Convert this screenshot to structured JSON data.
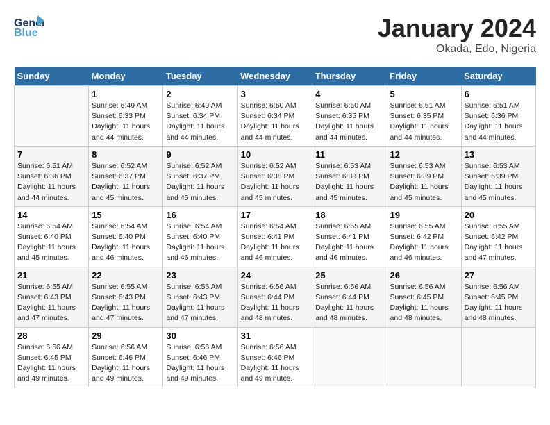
{
  "header": {
    "logo_general": "General",
    "logo_blue": "Blue",
    "month": "January 2024",
    "location": "Okada, Edo, Nigeria"
  },
  "weekdays": [
    "Sunday",
    "Monday",
    "Tuesday",
    "Wednesday",
    "Thursday",
    "Friday",
    "Saturday"
  ],
  "weeks": [
    [
      {
        "day": "",
        "sunrise": "",
        "sunset": "",
        "daylight": ""
      },
      {
        "day": "1",
        "sunrise": "Sunrise: 6:49 AM",
        "sunset": "Sunset: 6:33 PM",
        "daylight": "Daylight: 11 hours and 44 minutes."
      },
      {
        "day": "2",
        "sunrise": "Sunrise: 6:49 AM",
        "sunset": "Sunset: 6:34 PM",
        "daylight": "Daylight: 11 hours and 44 minutes."
      },
      {
        "day": "3",
        "sunrise": "Sunrise: 6:50 AM",
        "sunset": "Sunset: 6:34 PM",
        "daylight": "Daylight: 11 hours and 44 minutes."
      },
      {
        "day": "4",
        "sunrise": "Sunrise: 6:50 AM",
        "sunset": "Sunset: 6:35 PM",
        "daylight": "Daylight: 11 hours and 44 minutes."
      },
      {
        "day": "5",
        "sunrise": "Sunrise: 6:51 AM",
        "sunset": "Sunset: 6:35 PM",
        "daylight": "Daylight: 11 hours and 44 minutes."
      },
      {
        "day": "6",
        "sunrise": "Sunrise: 6:51 AM",
        "sunset": "Sunset: 6:36 PM",
        "daylight": "Daylight: 11 hours and 44 minutes."
      }
    ],
    [
      {
        "day": "7",
        "sunrise": "Sunrise: 6:51 AM",
        "sunset": "Sunset: 6:36 PM",
        "daylight": "Daylight: 11 hours and 44 minutes."
      },
      {
        "day": "8",
        "sunrise": "Sunrise: 6:52 AM",
        "sunset": "Sunset: 6:37 PM",
        "daylight": "Daylight: 11 hours and 45 minutes."
      },
      {
        "day": "9",
        "sunrise": "Sunrise: 6:52 AM",
        "sunset": "Sunset: 6:37 PM",
        "daylight": "Daylight: 11 hours and 45 minutes."
      },
      {
        "day": "10",
        "sunrise": "Sunrise: 6:52 AM",
        "sunset": "Sunset: 6:38 PM",
        "daylight": "Daylight: 11 hours and 45 minutes."
      },
      {
        "day": "11",
        "sunrise": "Sunrise: 6:53 AM",
        "sunset": "Sunset: 6:38 PM",
        "daylight": "Daylight: 11 hours and 45 minutes."
      },
      {
        "day": "12",
        "sunrise": "Sunrise: 6:53 AM",
        "sunset": "Sunset: 6:39 PM",
        "daylight": "Daylight: 11 hours and 45 minutes."
      },
      {
        "day": "13",
        "sunrise": "Sunrise: 6:53 AM",
        "sunset": "Sunset: 6:39 PM",
        "daylight": "Daylight: 11 hours and 45 minutes."
      }
    ],
    [
      {
        "day": "14",
        "sunrise": "Sunrise: 6:54 AM",
        "sunset": "Sunset: 6:40 PM",
        "daylight": "Daylight: 11 hours and 45 minutes."
      },
      {
        "day": "15",
        "sunrise": "Sunrise: 6:54 AM",
        "sunset": "Sunset: 6:40 PM",
        "daylight": "Daylight: 11 hours and 46 minutes."
      },
      {
        "day": "16",
        "sunrise": "Sunrise: 6:54 AM",
        "sunset": "Sunset: 6:40 PM",
        "daylight": "Daylight: 11 hours and 46 minutes."
      },
      {
        "day": "17",
        "sunrise": "Sunrise: 6:54 AM",
        "sunset": "Sunset: 6:41 PM",
        "daylight": "Daylight: 11 hours and 46 minutes."
      },
      {
        "day": "18",
        "sunrise": "Sunrise: 6:55 AM",
        "sunset": "Sunset: 6:41 PM",
        "daylight": "Daylight: 11 hours and 46 minutes."
      },
      {
        "day": "19",
        "sunrise": "Sunrise: 6:55 AM",
        "sunset": "Sunset: 6:42 PM",
        "daylight": "Daylight: 11 hours and 46 minutes."
      },
      {
        "day": "20",
        "sunrise": "Sunrise: 6:55 AM",
        "sunset": "Sunset: 6:42 PM",
        "daylight": "Daylight: 11 hours and 47 minutes."
      }
    ],
    [
      {
        "day": "21",
        "sunrise": "Sunrise: 6:55 AM",
        "sunset": "Sunset: 6:43 PM",
        "daylight": "Daylight: 11 hours and 47 minutes."
      },
      {
        "day": "22",
        "sunrise": "Sunrise: 6:55 AM",
        "sunset": "Sunset: 6:43 PM",
        "daylight": "Daylight: 11 hours and 47 minutes."
      },
      {
        "day": "23",
        "sunrise": "Sunrise: 6:56 AM",
        "sunset": "Sunset: 6:43 PM",
        "daylight": "Daylight: 11 hours and 47 minutes."
      },
      {
        "day": "24",
        "sunrise": "Sunrise: 6:56 AM",
        "sunset": "Sunset: 6:44 PM",
        "daylight": "Daylight: 11 hours and 48 minutes."
      },
      {
        "day": "25",
        "sunrise": "Sunrise: 6:56 AM",
        "sunset": "Sunset: 6:44 PM",
        "daylight": "Daylight: 11 hours and 48 minutes."
      },
      {
        "day": "26",
        "sunrise": "Sunrise: 6:56 AM",
        "sunset": "Sunset: 6:45 PM",
        "daylight": "Daylight: 11 hours and 48 minutes."
      },
      {
        "day": "27",
        "sunrise": "Sunrise: 6:56 AM",
        "sunset": "Sunset: 6:45 PM",
        "daylight": "Daylight: 11 hours and 48 minutes."
      }
    ],
    [
      {
        "day": "28",
        "sunrise": "Sunrise: 6:56 AM",
        "sunset": "Sunset: 6:45 PM",
        "daylight": "Daylight: 11 hours and 49 minutes."
      },
      {
        "day": "29",
        "sunrise": "Sunrise: 6:56 AM",
        "sunset": "Sunset: 6:46 PM",
        "daylight": "Daylight: 11 hours and 49 minutes."
      },
      {
        "day": "30",
        "sunrise": "Sunrise: 6:56 AM",
        "sunset": "Sunset: 6:46 PM",
        "daylight": "Daylight: 11 hours and 49 minutes."
      },
      {
        "day": "31",
        "sunrise": "Sunrise: 6:56 AM",
        "sunset": "Sunset: 6:46 PM",
        "daylight": "Daylight: 11 hours and 49 minutes."
      },
      {
        "day": "",
        "sunrise": "",
        "sunset": "",
        "daylight": ""
      },
      {
        "day": "",
        "sunrise": "",
        "sunset": "",
        "daylight": ""
      },
      {
        "day": "",
        "sunrise": "",
        "sunset": "",
        "daylight": ""
      }
    ]
  ]
}
